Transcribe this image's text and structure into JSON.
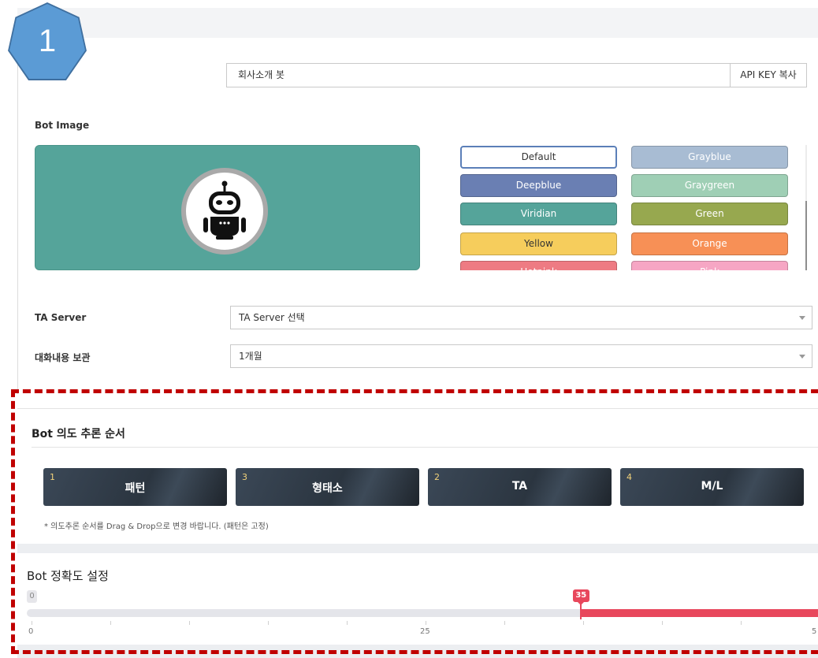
{
  "step_marker": "1",
  "bot_name": {
    "value": "회사소개 봇",
    "api_key_button": "API KEY 복사"
  },
  "bot_image": {
    "label": "Bot Image",
    "preview_color": "#55a49a",
    "icon": "robot-icon",
    "colors": [
      {
        "name": "Default",
        "color": "#ffffff",
        "text_color": "#333333",
        "selected": true
      },
      {
        "name": "Grayblue",
        "color": "#a8bcd3",
        "text_color": "#ffffff"
      },
      {
        "name": "Deepblue",
        "color": "#6a7fb3",
        "text_color": "#ffffff"
      },
      {
        "name": "Graygreen",
        "color": "#9fcfb5",
        "text_color": "#ffffff"
      },
      {
        "name": "Viridian",
        "color": "#55a49a",
        "text_color": "#ffffff"
      },
      {
        "name": "Green",
        "color": "#97a84f",
        "text_color": "#ffffff"
      },
      {
        "name": "Yellow",
        "color": "#f6cd5c",
        "text_color": "#333333"
      },
      {
        "name": "Orange",
        "color": "#f79056",
        "text_color": "#ffffff"
      },
      {
        "name": "Hotpink",
        "color": "#ee7b83",
        "text_color": "#ffffff"
      },
      {
        "name": "Pink",
        "color": "#f6a6c4",
        "text_color": "#ffffff"
      }
    ]
  },
  "ta_server": {
    "label": "TA Server",
    "value": "TA Server 선택"
  },
  "retention": {
    "label": "대화내용 보관",
    "value": "1개월"
  },
  "intent_order": {
    "title": "Bot 의도 추론 순서",
    "stages": [
      {
        "num": "1",
        "name": "패턴"
      },
      {
        "num": "3",
        "name": "형태소"
      },
      {
        "num": "2",
        "name": "TA"
      },
      {
        "num": "4",
        "name": "M/L"
      }
    ],
    "note": "* 의도추론 순서를 Drag & Drop으로 변경 바랍니다. (패턴은 고정)"
  },
  "accuracy": {
    "title": "Bot 정확도 설정",
    "min_badge": "0",
    "value": 35,
    "value_label": "35",
    "tick_labels": [
      "0",
      "25",
      "5"
    ],
    "accent_color": "#e8475c"
  }
}
